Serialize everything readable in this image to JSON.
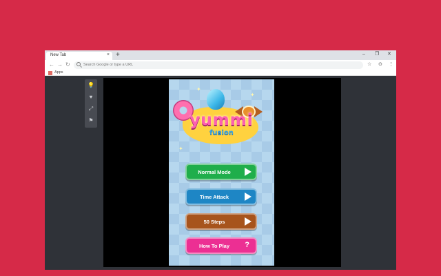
{
  "browser": {
    "tab_title": "New Tab",
    "tab_close": "×",
    "new_tab": "+",
    "window_controls": [
      "–",
      "❐",
      "✕"
    ],
    "nav": [
      "←",
      "→",
      "↻"
    ],
    "omnibox_placeholder": "Search Google or type a URL",
    "toolbar_right": [
      "☆",
      "⊙",
      "⋮"
    ],
    "apps_label": "Apps"
  },
  "side_toolbar": {
    "icons": [
      "lightbulb-icon",
      "heart-icon",
      "expand-icon",
      "flag-icon"
    ],
    "glyphs": [
      "💡",
      "♥",
      "⤢",
      "⚑"
    ]
  },
  "game": {
    "title": "yummi",
    "subtitle": "fusion",
    "buttons": [
      {
        "label": "Normal Mode",
        "color": "#1fae4b",
        "icon": "play-icon"
      },
      {
        "label": "Time Attack",
        "color": "#1e86c5",
        "icon": "play-icon"
      },
      {
        "label": "50 Steps",
        "color": "#a7541c",
        "icon": "play-icon"
      },
      {
        "label": "How To Play",
        "color": "#ec2f93",
        "icon": "help-icon",
        "glyph": "?"
      }
    ]
  }
}
